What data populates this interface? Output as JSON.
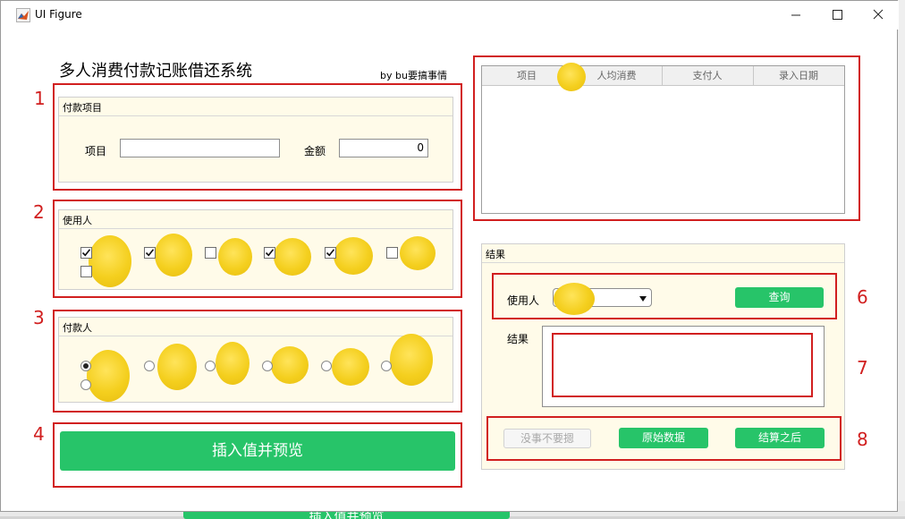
{
  "window": {
    "title": "UI Figure"
  },
  "app": {
    "title": "多人消费付款记账借还系统",
    "byline": "by bu要搞事情"
  },
  "annotations": [
    "1",
    "2",
    "3",
    "4",
    "5",
    "6",
    "7",
    "8"
  ],
  "payment_panel": {
    "title": "付款项目",
    "item_label": "项目",
    "item_value": "",
    "amount_label": "金额",
    "amount_value": "0"
  },
  "users_panel": {
    "title": "使用人",
    "checkboxes": [
      true,
      true,
      false,
      true,
      true,
      false,
      false
    ]
  },
  "payer_panel": {
    "title": "付款人",
    "radios": [
      true,
      false,
      false,
      false,
      false,
      false,
      false
    ]
  },
  "insert_button": "插入值并预览",
  "table": {
    "columns": [
      "项目",
      "人均消费",
      "支付人",
      "录入日期"
    ]
  },
  "results_panel": {
    "title": "结果",
    "user_label": "使用人",
    "query_button": "查询",
    "result_label": "结果"
  },
  "buttons": {
    "disabled": "没事不要摁",
    "raw": "原始数据",
    "settle": "结算之后"
  },
  "background_peek": "插入值并预览",
  "colors": {
    "accent_green": "#27c469",
    "annotation_red": "#d11f1f",
    "panel_bg": "#fffbe9",
    "redaction": "#f4cf1e"
  }
}
